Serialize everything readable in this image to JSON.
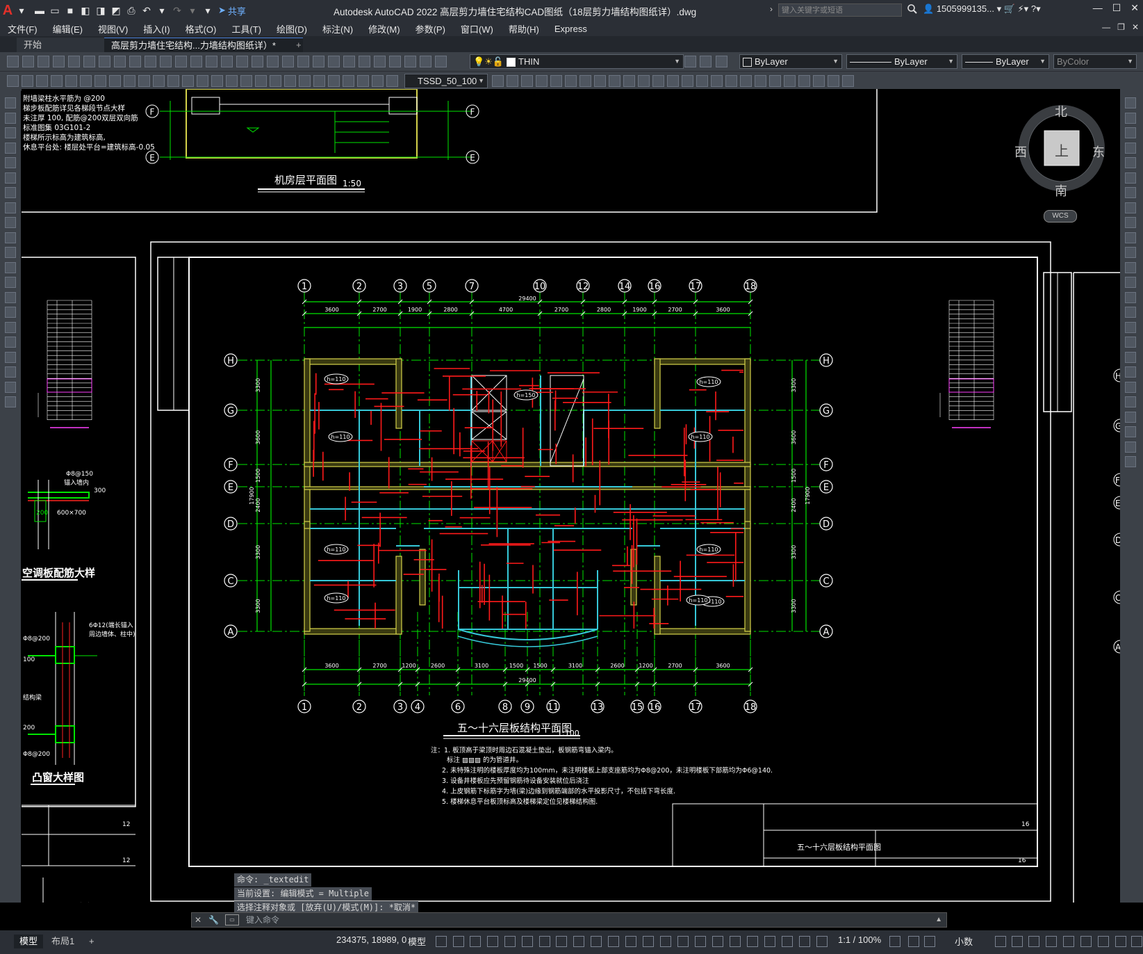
{
  "titlebar": {
    "app_logo": "A",
    "share_label": "共享",
    "title": "Autodesk AutoCAD 2022    高层剪力墙住宅结构CAD图纸（18层剪力墙结构图纸详）.dwg",
    "search_placeholder": "键入关键字或短语",
    "user": "1505999135..."
  },
  "menu": [
    "文件(F)",
    "编辑(E)",
    "视图(V)",
    "插入(I)",
    "格式(O)",
    "工具(T)",
    "绘图(D)",
    "标注(N)",
    "修改(M)",
    "参数(P)",
    "窗口(W)",
    "帮助(H)",
    "Express"
  ],
  "tabs": {
    "start": "开始",
    "doc": "高层剪力墙住宅结构...力墙结构图纸详）*",
    "add": "+"
  },
  "toolbar": {
    "layer_name": "THIN",
    "color": "ByLayer",
    "linetype": "ByLayer",
    "lineweight": "ByLayer",
    "plotstyle": "ByColor",
    "text_style": "TSSD_50_100"
  },
  "viewcube": {
    "north": "北",
    "south": "南",
    "east": "东",
    "west": "西",
    "top": "上",
    "wcs": "WCS"
  },
  "drawing": {
    "top_notes": [
      "附墙梁柱水平筋为  @200",
      "梯步板配筋详见各梯段节点大样",
      "未注厚 100, 配筋@200双层双向筋",
      "标准图集 03G101-2",
      "楼梯所示标高为建筑标高,",
      "休息平台处: 楼层处平台=建筑标高-0.05"
    ],
    "machine_room_title": "机房层平面图",
    "machine_room_scale": "1:50",
    "plan_title": "五～十六层板结构平面图",
    "plan_scale": "1:100",
    "top_axes": [
      "1",
      "2",
      "3",
      "5",
      "7",
      "10",
      "12",
      "14",
      "16",
      "17",
      "18"
    ],
    "bottom_axes": [
      "1",
      "2",
      "3",
      "4",
      "6",
      "8",
      "9",
      "11",
      "13",
      "15",
      "16",
      "17",
      "18"
    ],
    "side_axes": [
      "H",
      "G",
      "F",
      "E",
      "D",
      "C",
      "A"
    ],
    "top_dims": [
      "3600",
      "2700",
      "1900",
      "2800",
      "4700",
      "2700",
      "2800",
      "1900",
      "2700",
      "3600"
    ],
    "top_total": "29400",
    "bottom_dims": [
      "3600",
      "2700",
      "1200",
      "2600",
      "3100",
      "1500",
      "1500",
      "3100",
      "2600",
      "1200",
      "2700",
      "3600"
    ],
    "bottom_total": "29400",
    "left_dims": [
      "3300",
      "3600",
      "1500",
      "2400",
      "3300",
      "3300"
    ],
    "left_total": "17900",
    "slab_tags": [
      "h=110",
      "h=110",
      "h=110",
      "h=110",
      "h=150",
      "h=110",
      "h=110",
      "h=110",
      "h=110",
      "h=110"
    ],
    "notes": [
      "注：1. 板顶高于梁顶时周边石混凝土垫出，板钢筋弯锚入梁内。",
      "标注 ▨▨▨ 的为管道井。",
      "2. 未特殊注明的楼板厚度均为100mm，未注明楼板上部支座筋均为Φ8@200，未注明楼板下部筋均为Φ6@140.",
      "3. 设备井楼板应先预留钢筋待设备安装就位后浇注",
      "4. 上皮钢筋下标筋字为墙(梁)边缘到钢筋端部的水平投影尺寸，不包括下弯长度.",
      "5. 楼梯休息平台板顶标高及楼梯梁定位见楼梯结构图."
    ],
    "detail1_title": "空调板配筋大样",
    "detail2_title": "凸窗大样图",
    "detail_labels": [
      "Φ8@150",
      "锚入墙内",
      "300",
      "200",
      "600×700",
      "6Φ12(端长锚入",
      "周边墙体、柱中)",
      "Φ8@200",
      "结构梁",
      "200",
      "100",
      "Φ8@200"
    ],
    "title_block": "五～十六层板结构平面图",
    "sheet_no": "16",
    "left_sheet_no": "12"
  },
  "command": {
    "history": [
      "命令: _textedit",
      "当前设置: 编辑模式 = Multiple",
      "选择注释对象或 [放弃(U)/模式(M)]: *取消*"
    ],
    "placeholder": "键入命令"
  },
  "status": {
    "model_tab": "模型",
    "layout_tab": "布局1",
    "add": "+",
    "coords": "234375, 18989, 0",
    "space": "模型",
    "scale": "1:1 / 100%",
    "units": "小数"
  },
  "colors": {
    "accent": "#4a7fd6",
    "wall": "#d4d24a",
    "rebar": "#ff1a1a",
    "grid": "#00e600",
    "axis": "#ffffff",
    "cyan": "#36c8d8"
  }
}
